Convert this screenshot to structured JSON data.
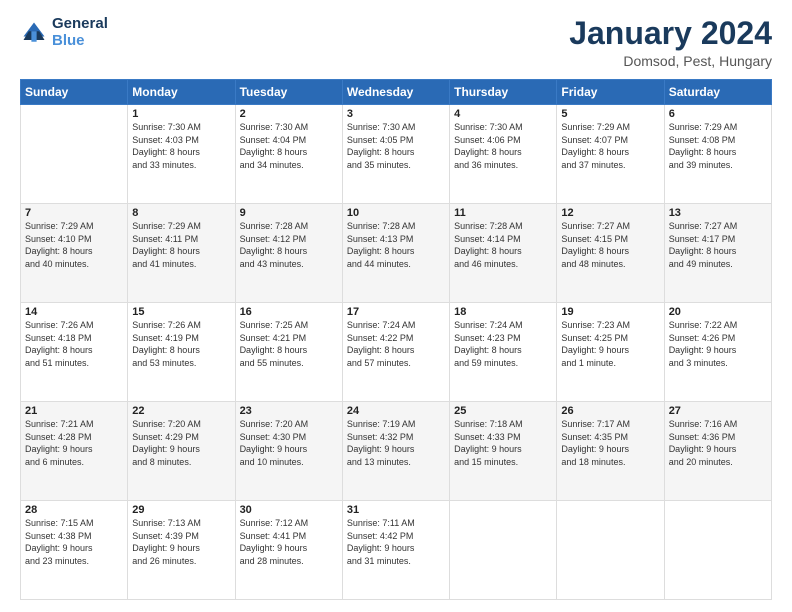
{
  "header": {
    "logo_line1": "General",
    "logo_line2": "Blue",
    "month_title": "January 2024",
    "location": "Domsod, Pest, Hungary"
  },
  "weekdays": [
    "Sunday",
    "Monday",
    "Tuesday",
    "Wednesday",
    "Thursday",
    "Friday",
    "Saturday"
  ],
  "weeks": [
    [
      {
        "day": "",
        "info": ""
      },
      {
        "day": "1",
        "info": "Sunrise: 7:30 AM\nSunset: 4:03 PM\nDaylight: 8 hours\nand 33 minutes."
      },
      {
        "day": "2",
        "info": "Sunrise: 7:30 AM\nSunset: 4:04 PM\nDaylight: 8 hours\nand 34 minutes."
      },
      {
        "day": "3",
        "info": "Sunrise: 7:30 AM\nSunset: 4:05 PM\nDaylight: 8 hours\nand 35 minutes."
      },
      {
        "day": "4",
        "info": "Sunrise: 7:30 AM\nSunset: 4:06 PM\nDaylight: 8 hours\nand 36 minutes."
      },
      {
        "day": "5",
        "info": "Sunrise: 7:29 AM\nSunset: 4:07 PM\nDaylight: 8 hours\nand 37 minutes."
      },
      {
        "day": "6",
        "info": "Sunrise: 7:29 AM\nSunset: 4:08 PM\nDaylight: 8 hours\nand 39 minutes."
      }
    ],
    [
      {
        "day": "7",
        "info": "Sunrise: 7:29 AM\nSunset: 4:10 PM\nDaylight: 8 hours\nand 40 minutes."
      },
      {
        "day": "8",
        "info": "Sunrise: 7:29 AM\nSunset: 4:11 PM\nDaylight: 8 hours\nand 41 minutes."
      },
      {
        "day": "9",
        "info": "Sunrise: 7:28 AM\nSunset: 4:12 PM\nDaylight: 8 hours\nand 43 minutes."
      },
      {
        "day": "10",
        "info": "Sunrise: 7:28 AM\nSunset: 4:13 PM\nDaylight: 8 hours\nand 44 minutes."
      },
      {
        "day": "11",
        "info": "Sunrise: 7:28 AM\nSunset: 4:14 PM\nDaylight: 8 hours\nand 46 minutes."
      },
      {
        "day": "12",
        "info": "Sunrise: 7:27 AM\nSunset: 4:15 PM\nDaylight: 8 hours\nand 48 minutes."
      },
      {
        "day": "13",
        "info": "Sunrise: 7:27 AM\nSunset: 4:17 PM\nDaylight: 8 hours\nand 49 minutes."
      }
    ],
    [
      {
        "day": "14",
        "info": "Sunrise: 7:26 AM\nSunset: 4:18 PM\nDaylight: 8 hours\nand 51 minutes."
      },
      {
        "day": "15",
        "info": "Sunrise: 7:26 AM\nSunset: 4:19 PM\nDaylight: 8 hours\nand 53 minutes."
      },
      {
        "day": "16",
        "info": "Sunrise: 7:25 AM\nSunset: 4:21 PM\nDaylight: 8 hours\nand 55 minutes."
      },
      {
        "day": "17",
        "info": "Sunrise: 7:24 AM\nSunset: 4:22 PM\nDaylight: 8 hours\nand 57 minutes."
      },
      {
        "day": "18",
        "info": "Sunrise: 7:24 AM\nSunset: 4:23 PM\nDaylight: 8 hours\nand 59 minutes."
      },
      {
        "day": "19",
        "info": "Sunrise: 7:23 AM\nSunset: 4:25 PM\nDaylight: 9 hours\nand 1 minute."
      },
      {
        "day": "20",
        "info": "Sunrise: 7:22 AM\nSunset: 4:26 PM\nDaylight: 9 hours\nand 3 minutes."
      }
    ],
    [
      {
        "day": "21",
        "info": "Sunrise: 7:21 AM\nSunset: 4:28 PM\nDaylight: 9 hours\nand 6 minutes."
      },
      {
        "day": "22",
        "info": "Sunrise: 7:20 AM\nSunset: 4:29 PM\nDaylight: 9 hours\nand 8 minutes."
      },
      {
        "day": "23",
        "info": "Sunrise: 7:20 AM\nSunset: 4:30 PM\nDaylight: 9 hours\nand 10 minutes."
      },
      {
        "day": "24",
        "info": "Sunrise: 7:19 AM\nSunset: 4:32 PM\nDaylight: 9 hours\nand 13 minutes."
      },
      {
        "day": "25",
        "info": "Sunrise: 7:18 AM\nSunset: 4:33 PM\nDaylight: 9 hours\nand 15 minutes."
      },
      {
        "day": "26",
        "info": "Sunrise: 7:17 AM\nSunset: 4:35 PM\nDaylight: 9 hours\nand 18 minutes."
      },
      {
        "day": "27",
        "info": "Sunrise: 7:16 AM\nSunset: 4:36 PM\nDaylight: 9 hours\nand 20 minutes."
      }
    ],
    [
      {
        "day": "28",
        "info": "Sunrise: 7:15 AM\nSunset: 4:38 PM\nDaylight: 9 hours\nand 23 minutes."
      },
      {
        "day": "29",
        "info": "Sunrise: 7:13 AM\nSunset: 4:39 PM\nDaylight: 9 hours\nand 26 minutes."
      },
      {
        "day": "30",
        "info": "Sunrise: 7:12 AM\nSunset: 4:41 PM\nDaylight: 9 hours\nand 28 minutes."
      },
      {
        "day": "31",
        "info": "Sunrise: 7:11 AM\nSunset: 4:42 PM\nDaylight: 9 hours\nand 31 minutes."
      },
      {
        "day": "",
        "info": ""
      },
      {
        "day": "",
        "info": ""
      },
      {
        "day": "",
        "info": ""
      }
    ]
  ]
}
